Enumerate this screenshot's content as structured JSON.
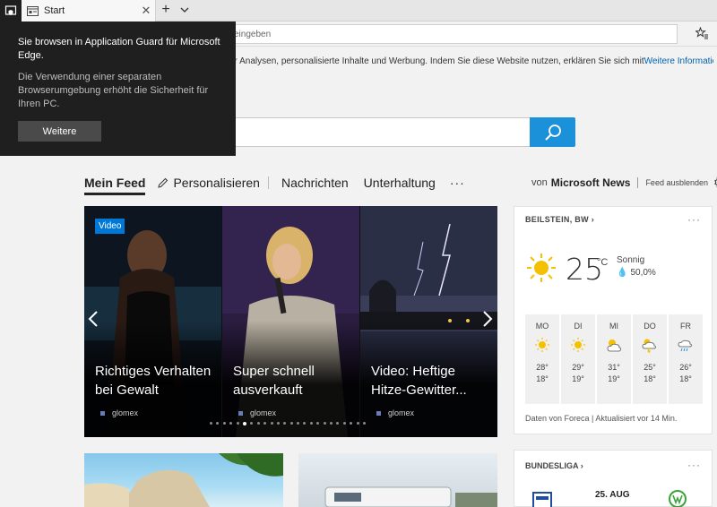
{
  "tabs": {
    "active_title": "Start",
    "close_glyph": "✕",
    "new_tab_glyph": "+"
  },
  "addressbar": {
    "placeholder_fragment": "eingeben"
  },
  "cookie": {
    "text": "ür Analysen, personalisierte Inhalte und Werbung. Indem Sie diese Website nutzen, erklären Sie sich mit",
    "link": "Weitere Informationen"
  },
  "guard": {
    "title": "Sie browsen in Application Guard für Microsoft Edge.",
    "body": "Die Verwendung einer separaten Browserumgebung erhöht die Sicherheit für Ihren PC.",
    "button": "Weitere"
  },
  "feed_nav": {
    "active": "Mein Feed",
    "personalize": "Personalisieren",
    "news": "Nachrichten",
    "entertainment": "Unterhaltung",
    "more": "···"
  },
  "source": {
    "prefix": "von",
    "brand": "Microsoft News",
    "hide": "Feed ausblenden"
  },
  "carousel": {
    "slides": [
      {
        "badge": "Video",
        "headline": "Richtiges Verhalten bei Gewalt",
        "provider": "glomex"
      },
      {
        "headline": "Super schnell ausverkauft",
        "provider": "glomex"
      },
      {
        "headline": "Video: Heftige Hitze-Gewitter...",
        "provider": "glomex"
      }
    ],
    "dot_count": 24,
    "active_dot": 5
  },
  "weather": {
    "location": "BEILSTEIN, BW",
    "temp": "25",
    "unit": "°C",
    "condition": "Sonnig",
    "humidity": "50,0%",
    "days": [
      {
        "name": "MO",
        "icon": "sun-icon",
        "hi": "28°",
        "lo": "18°"
      },
      {
        "name": "DI",
        "icon": "sun-icon",
        "hi": "29°",
        "lo": "19°"
      },
      {
        "name": "MI",
        "icon": "partly-cloudy-icon",
        "hi": "31°",
        "lo": "19°"
      },
      {
        "name": "DO",
        "icon": "thunder-icon",
        "hi": "25°",
        "lo": "18°"
      },
      {
        "name": "FR",
        "icon": "rain-icon",
        "hi": "26°",
        "lo": "18°"
      }
    ],
    "footer": "Daten von Foreca | Aktualisiert vor 14 Min."
  },
  "bundesliga": {
    "title": "BUNDESLIGA",
    "date": "25. AUG"
  },
  "colors": {
    "accent": "#1a91d9",
    "dark_popup": "#1f1f1f",
    "video_badge": "#0078d7"
  }
}
